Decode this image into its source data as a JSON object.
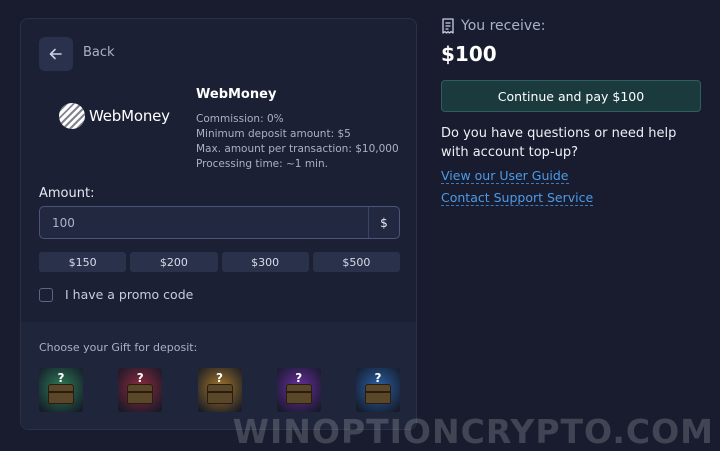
{
  "back": {
    "label": "Back",
    "icon": "arrow-left-icon"
  },
  "method": {
    "logo_text": "WebMoney",
    "name": "WebMoney",
    "info": [
      "Commission: 0%",
      "Minimum deposit amount: $5",
      "Max. amount per transaction: $10,000",
      "Processing time: ~1 min."
    ]
  },
  "amount": {
    "label": "Amount:",
    "value": "100",
    "currency": "$"
  },
  "quick_amounts": [
    "$150",
    "$200",
    "$300",
    "$500"
  ],
  "promo": {
    "label": "I have a promo code",
    "checked": false
  },
  "gifts": {
    "title": "Choose your Gift for deposit:",
    "items": [
      {
        "name": "gift-green",
        "color": "#2e7d58",
        "mark": "?"
      },
      {
        "name": "gift-red",
        "color": "#8e2b3f",
        "mark": "?"
      },
      {
        "name": "gift-gold",
        "color": "#a2762a",
        "mark": "?"
      },
      {
        "name": "gift-purple",
        "color": "#6a2fa0",
        "mark": "?"
      },
      {
        "name": "gift-blue",
        "color": "#2b62a8",
        "mark": "?"
      }
    ]
  },
  "summary": {
    "receive_label": "You receive:",
    "receive_amount": "$100",
    "pay_button": "Continue and pay $100",
    "help_text": "Do you have questions or need help with account top-up?",
    "links": [
      "View our User Guide",
      "Contact Support Service"
    ]
  },
  "watermark": "WINOPTIONCRYPTO.COM",
  "colors": {
    "background": "#181c2e",
    "panel": "#1b2034",
    "accent_button": "#1b3a3e",
    "link": "#4d9be8"
  }
}
